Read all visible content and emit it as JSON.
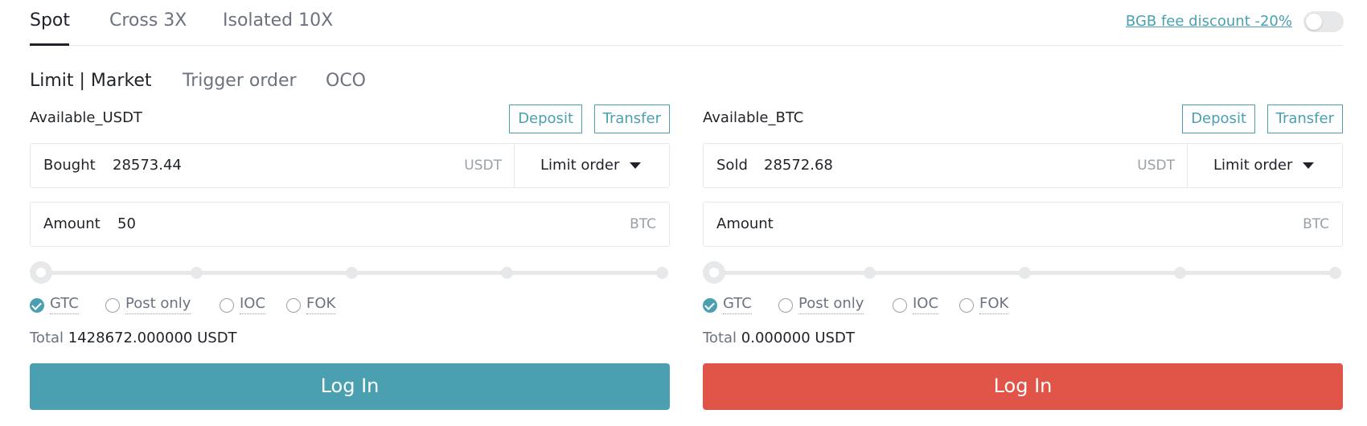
{
  "colors": {
    "accent": "#4aa0b1",
    "sell": "#e05548",
    "border": "#e6e8ea",
    "text_primary": "#1f2329",
    "text_muted": "#6b7280"
  },
  "margin_tabs": [
    {
      "label": "Spot",
      "active": true
    },
    {
      "label": "Cross 3X",
      "active": false
    },
    {
      "label": "Isolated 10X",
      "active": false
    }
  ],
  "fee_discount": {
    "label": "BGB fee discount -20%",
    "enabled": false
  },
  "order_tabs": [
    {
      "label": "Limit | Market",
      "active": true
    },
    {
      "label": "Trigger order",
      "active": false
    },
    {
      "label": "OCO",
      "active": false
    }
  ],
  "buy": {
    "available_label": "Available_USDT",
    "deposit_label": "Deposit",
    "transfer_label": "Transfer",
    "price_label": "Bought",
    "price_value": "28573.44",
    "price_unit": "USDT",
    "order_type": "Limit order",
    "amount_label": "Amount",
    "amount_value": "50",
    "amount_unit": "BTC",
    "slider_percent": 0,
    "tif_options": [
      {
        "label": "GTC",
        "checked": true
      },
      {
        "label": "Post only",
        "checked": false
      },
      {
        "label": "IOC",
        "checked": false
      },
      {
        "label": "FOK",
        "checked": false
      }
    ],
    "total_label": "Total",
    "total_value": "1428672.000000 USDT",
    "login_label": "Log In"
  },
  "sell": {
    "available_label": "Available_BTC",
    "deposit_label": "Deposit",
    "transfer_label": "Transfer",
    "price_label": "Sold",
    "price_value": "28572.68",
    "price_unit": "USDT",
    "order_type": "Limit order",
    "amount_label": "Amount",
    "amount_value": "",
    "amount_unit": "BTC",
    "slider_percent": 0,
    "tif_options": [
      {
        "label": "GTC",
        "checked": true
      },
      {
        "label": "Post only",
        "checked": false
      },
      {
        "label": "IOC",
        "checked": false
      },
      {
        "label": "FOK",
        "checked": false
      }
    ],
    "total_label": "Total",
    "total_value": "0.000000 USDT",
    "login_label": "Log In"
  }
}
